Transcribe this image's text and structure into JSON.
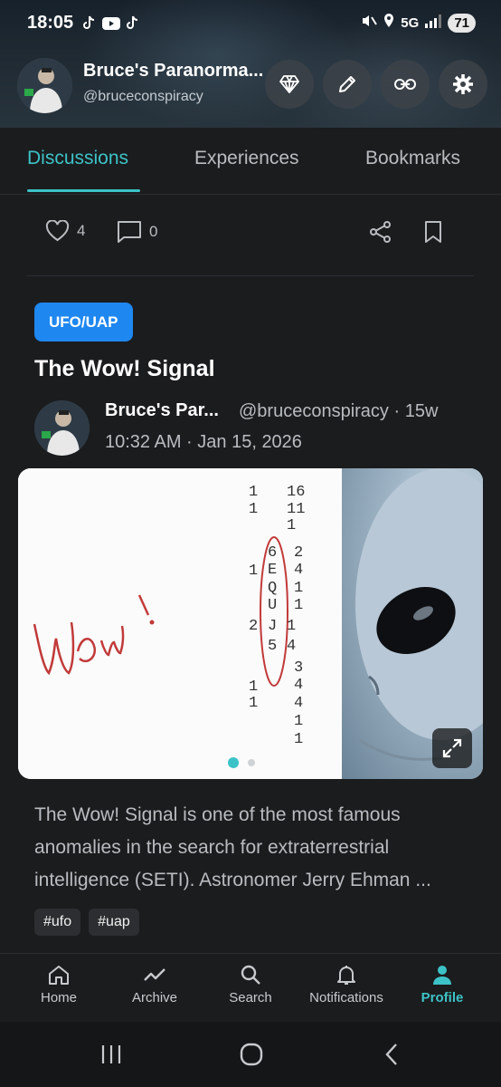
{
  "status_bar": {
    "time": "18:05",
    "network": "5G",
    "battery": "71"
  },
  "header": {
    "profile_name": "Bruce's Paranorma...",
    "profile_handle": "@bruceconspiracy",
    "buttons": [
      "diamond-icon",
      "pencil-icon",
      "link-icon",
      "gear-icon"
    ]
  },
  "tabs": [
    {
      "label": "Discussions",
      "active": true
    },
    {
      "label": "Experiences",
      "active": false
    },
    {
      "label": "Bookmarks",
      "active": false
    }
  ],
  "previous_post": {
    "likes": "4",
    "comments": "0"
  },
  "post": {
    "category": "UFO/UAP",
    "title": "The Wow! Signal",
    "author_name": "Bruce's Par...",
    "author_meta": "@bruceconspiracy · 15w",
    "timestamp": "10:32 AM · Jan 15, 2026",
    "media_text": {
      "wow": "Wow!",
      "column1": [
        "1",
        "1",
        "",
        "",
        "1",
        "",
        "",
        "2",
        "",
        "1",
        "1"
      ],
      "column2": [
        "16",
        "11",
        "1",
        "",
        "2",
        "4",
        "1",
        "1",
        "1",
        "4",
        "3",
        "4",
        "4",
        "1",
        "1"
      ],
      "letters": [
        "6",
        "E",
        "Q",
        "U",
        "J",
        "5"
      ]
    },
    "body": "The Wow! Signal is one of the most famous anomalies in the search for extraterrestrial intelligence (SETI). Astronomer Jerry Ehman ...",
    "tags": [
      "#ufo",
      "#uap"
    ]
  },
  "bottom_nav": [
    {
      "label": "Home",
      "icon": "home-icon",
      "active": false
    },
    {
      "label": "Archive",
      "icon": "chart-line-icon",
      "active": false
    },
    {
      "label": "Search",
      "icon": "search-icon",
      "active": false
    },
    {
      "label": "Notifications",
      "icon": "bell-icon",
      "active": false
    },
    {
      "label": "Profile",
      "icon": "person-icon",
      "active": true
    }
  ],
  "colors": {
    "accent": "#3cc3c7",
    "category_badge": "#1f87f0",
    "background": "#1b1c1e"
  }
}
